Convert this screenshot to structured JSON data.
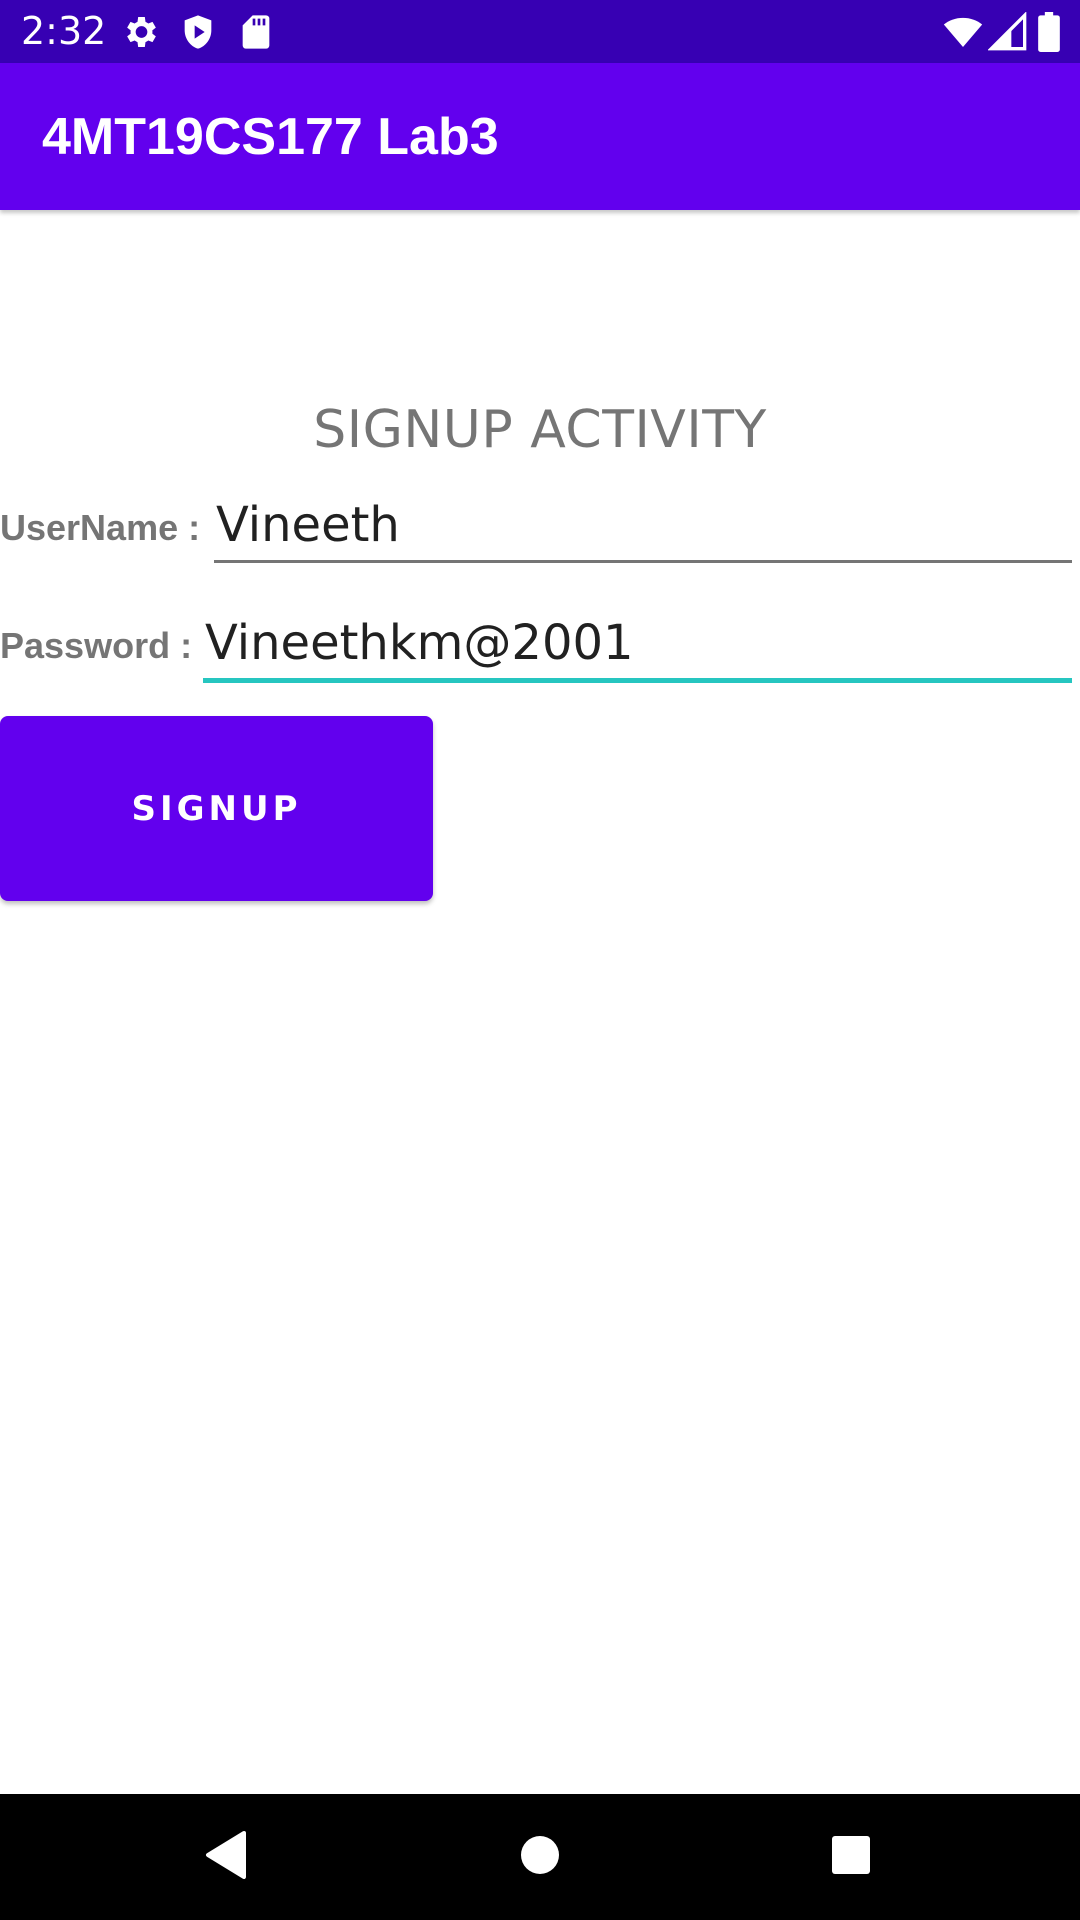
{
  "status_bar": {
    "time": "2:32",
    "icons_left": [
      "gear-icon",
      "shield-play-icon",
      "sd-card-icon"
    ],
    "icons_right": [
      "wifi-icon",
      "signal-icon",
      "battery-icon"
    ]
  },
  "app_bar": {
    "title": "4MT19CS177 Lab3",
    "color": "#6200ee"
  },
  "main": {
    "heading": "SIGNUP ACTIVITY",
    "username": {
      "label": "UserName :",
      "value": "Vineeth"
    },
    "password": {
      "label": "Password :",
      "value": "Vineethkm@2001"
    },
    "signup_button": {
      "label": "SIGNUP"
    }
  },
  "nav_bar": {
    "buttons": [
      "back-icon",
      "home-icon",
      "recents-icon"
    ]
  },
  "colors": {
    "status_bar": "#3700b3",
    "primary": "#6200ee",
    "focus_accent": "#26c6c0"
  }
}
